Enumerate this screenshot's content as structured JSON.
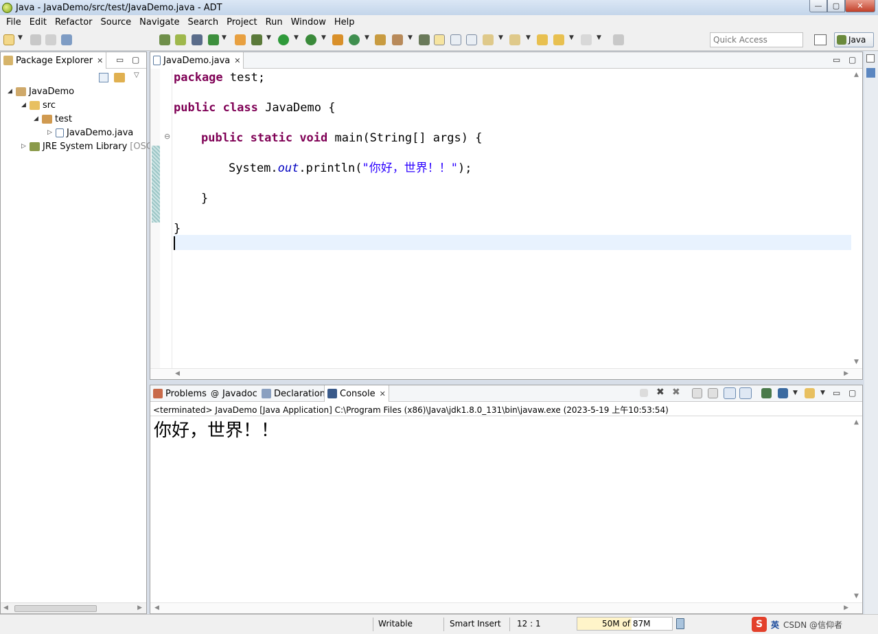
{
  "window": {
    "title": "Java - JavaDemo/src/test/JavaDemo.java - ADT",
    "minimize": "—",
    "maximize": "▢",
    "close": "✕"
  },
  "menu": [
    "File",
    "Edit",
    "Refactor",
    "Source",
    "Navigate",
    "Search",
    "Project",
    "Run",
    "Window",
    "Help"
  ],
  "toolbar": {
    "quick_access_placeholder": "Quick Access",
    "perspective": "Java"
  },
  "package_explorer": {
    "tab_label": "Package Explorer",
    "tree": [
      {
        "label": "JavaDemo",
        "icon": "project-icon",
        "expanded": true
      },
      {
        "label": "src",
        "icon": "source-folder-icon",
        "expanded": true
      },
      {
        "label": "test",
        "icon": "package-icon",
        "expanded": true
      },
      {
        "label": "JavaDemo.java",
        "icon": "java-file-icon",
        "expanded": false
      },
      {
        "label": "JRE System Library",
        "decoration": "[OSGi",
        "icon": "library-icon",
        "expanded": false
      }
    ]
  },
  "editor": {
    "tab_label": "JavaDemo.java",
    "code": {
      "l1_kw": "package",
      "l1_rest": " test;",
      "l2_kw1": "public",
      "l2_kw2": " class",
      "l2_rest": " JavaDemo {",
      "l3_kw1": "public",
      "l3_kw2": " static",
      "l3_kw3": " void",
      "l3_rest": " main(String[] args) {",
      "l4_a": "System.",
      "l4_field": "out",
      "l4_b": ".println(",
      "l4_str": "\"你好，世界！！\"",
      "l4_c": ");",
      "l5": "}",
      "l6": "}"
    }
  },
  "bottom_panel": {
    "tabs": [
      "Problems",
      "Javadoc",
      "Declaration",
      "Console"
    ],
    "console_header": "<terminated> JavaDemo [Java Application] C:\\Program Files (x86)\\Java\\jdk1.8.0_131\\bin\\javaw.exe (2023-5-19 上午10:53:54)",
    "console_output": "你好，世界！！"
  },
  "statusbar": {
    "writable": "Writable",
    "insert_mode": "Smart Insert",
    "position": "12 : 1",
    "heap": "50M of 87M",
    "heap_fraction": 0.575,
    "ime": "英",
    "watermark": "CSDN @信仰者"
  },
  "colors": {
    "keyword": "#7f0055",
    "string": "#2a00ff",
    "field": "#0000c0",
    "current_line": "#e8f2fe"
  }
}
